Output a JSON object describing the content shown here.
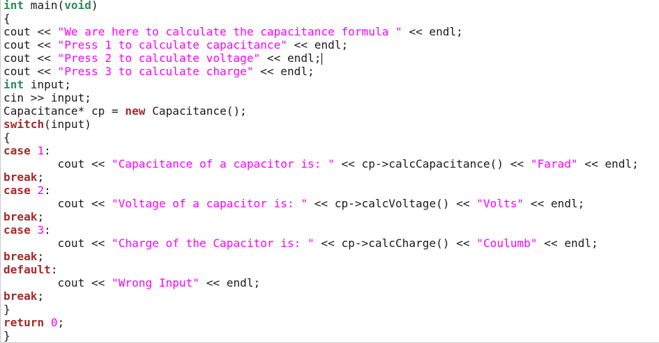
{
  "colors": {
    "type": "#2e8b57",
    "keyword": "#a52a2a",
    "string": "#ff00ff",
    "number": "#ff00ff",
    "plain": "#1a1a1a",
    "background": "#ffffff"
  },
  "editor": {
    "caret_line_index": 4,
    "lines": [
      [
        {
          "t": "type",
          "v": "int"
        },
        {
          "t": "plain",
          "v": " main("
        },
        {
          "t": "type",
          "v": "void"
        },
        {
          "t": "plain",
          "v": ")"
        }
      ],
      [
        {
          "t": "plain",
          "v": "{"
        }
      ],
      [
        {
          "t": "plain",
          "v": "cout << "
        },
        {
          "t": "str",
          "v": "\"We are here to calculate the capacitance formula \""
        },
        {
          "t": "plain",
          "v": " << endl;"
        }
      ],
      [
        {
          "t": "plain",
          "v": "cout << "
        },
        {
          "t": "str",
          "v": "\"Press 1 to calculate capacitance\""
        },
        {
          "t": "plain",
          "v": " << endl;"
        }
      ],
      [
        {
          "t": "plain",
          "v": "cout << "
        },
        {
          "t": "str",
          "v": "\"Press 2 to calculate voltage\""
        },
        {
          "t": "plain",
          "v": " << endl;"
        }
      ],
      [
        {
          "t": "plain",
          "v": "cout << "
        },
        {
          "t": "str",
          "v": "\"Press 3 to calculate charge\""
        },
        {
          "t": "plain",
          "v": " << endl;"
        }
      ],
      [
        {
          "t": "type",
          "v": "int"
        },
        {
          "t": "plain",
          "v": " input;"
        }
      ],
      [
        {
          "t": "plain",
          "v": "cin >> input;"
        }
      ],
      [
        {
          "t": "plain",
          "v": "Capacitance* cp = "
        },
        {
          "t": "kw",
          "v": "new"
        },
        {
          "t": "plain",
          "v": " Capacitance();"
        }
      ],
      [
        {
          "t": "kw",
          "v": "switch"
        },
        {
          "t": "plain",
          "v": "(input)"
        }
      ],
      [
        {
          "t": "plain",
          "v": "{"
        }
      ],
      [
        {
          "t": "kw",
          "v": "case"
        },
        {
          "t": "plain",
          "v": " "
        },
        {
          "t": "num",
          "v": "1"
        },
        {
          "t": "plain",
          "v": ":"
        }
      ],
      [
        {
          "t": "plain",
          "v": "        cout << "
        },
        {
          "t": "str",
          "v": "\"Capacitance of a capacitor is: \""
        },
        {
          "t": "plain",
          "v": " << cp->calcCapacitance() << "
        },
        {
          "t": "str",
          "v": "\"Farad\""
        },
        {
          "t": "plain",
          "v": " << endl;"
        }
      ],
      [
        {
          "t": "kw",
          "v": "break"
        },
        {
          "t": "plain",
          "v": ";"
        }
      ],
      [
        {
          "t": "kw",
          "v": "case"
        },
        {
          "t": "plain",
          "v": " "
        },
        {
          "t": "num",
          "v": "2"
        },
        {
          "t": "plain",
          "v": ":"
        }
      ],
      [
        {
          "t": "plain",
          "v": "        cout << "
        },
        {
          "t": "str",
          "v": "\"Voltage of a capacitor is: \""
        },
        {
          "t": "plain",
          "v": " << cp->calcVoltage() << "
        },
        {
          "t": "str",
          "v": "\"Volts\""
        },
        {
          "t": "plain",
          "v": " << endl;"
        }
      ],
      [
        {
          "t": "kw",
          "v": "break"
        },
        {
          "t": "plain",
          "v": ";"
        }
      ],
      [
        {
          "t": "kw",
          "v": "case"
        },
        {
          "t": "plain",
          "v": " "
        },
        {
          "t": "num",
          "v": "3"
        },
        {
          "t": "plain",
          "v": ":"
        }
      ],
      [
        {
          "t": "plain",
          "v": "        cout << "
        },
        {
          "t": "str",
          "v": "\"Charge of the Capacitor is: \""
        },
        {
          "t": "plain",
          "v": " << cp->calcCharge() << "
        },
        {
          "t": "str",
          "v": "\"Coulumb\""
        },
        {
          "t": "plain",
          "v": " << endl;"
        }
      ],
      [
        {
          "t": "kw",
          "v": "break"
        },
        {
          "t": "plain",
          "v": ";"
        }
      ],
      [
        {
          "t": "kw",
          "v": "default"
        },
        {
          "t": "plain",
          "v": ":"
        }
      ],
      [
        {
          "t": "plain",
          "v": "        cout << "
        },
        {
          "t": "str",
          "v": "\"Wrong Input\""
        },
        {
          "t": "plain",
          "v": " << endl;"
        }
      ],
      [
        {
          "t": "kw",
          "v": "break"
        },
        {
          "t": "plain",
          "v": ";"
        }
      ],
      [
        {
          "t": "plain",
          "v": "}"
        }
      ],
      [
        {
          "t": "kw",
          "v": "return"
        },
        {
          "t": "plain",
          "v": " "
        },
        {
          "t": "num",
          "v": "0"
        },
        {
          "t": "plain",
          "v": ";"
        }
      ],
      [
        {
          "t": "plain",
          "v": "}"
        }
      ]
    ]
  }
}
